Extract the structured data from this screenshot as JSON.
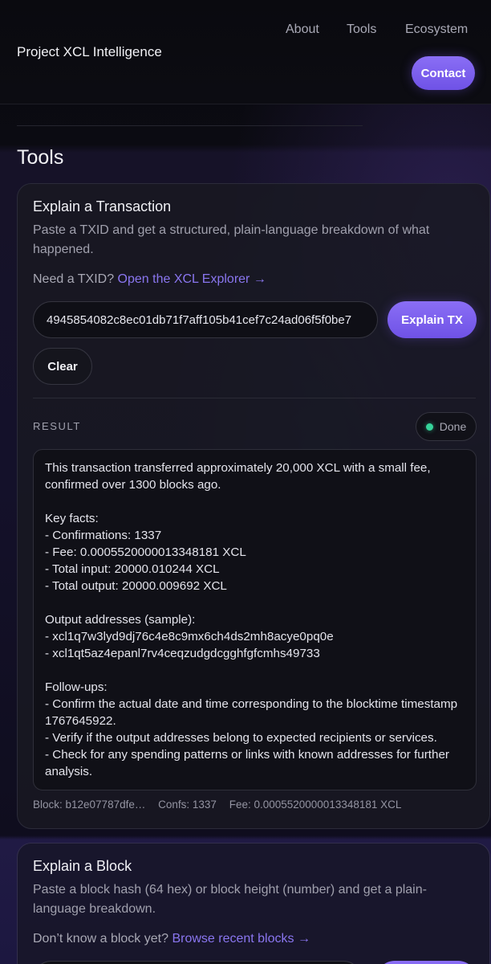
{
  "header": {
    "brand": "Project XCL Intelligence",
    "nav": [
      "About",
      "Tools",
      "Ecosystem"
    ],
    "contact_label": "Contact"
  },
  "section_title": "Tools",
  "tx_card": {
    "title": "Explain a Transaction",
    "description": "Paste a TXID and get a structured, plain-language breakdown of what happened.",
    "need_prefix": "Need a TXID?",
    "need_link": "Open the XCL Explorer →",
    "txid_value": "4945854082c8ec01db71f7aff105b41cef7c24ad06f5f0be7",
    "explain_label": "Explain TX",
    "clear_label": "Clear",
    "result_label": "RESULT",
    "status": "Done",
    "result_text": "This transaction transferred approximately 20,000 XCL with a small fee, confirmed over 1300 blocks ago.\n\nKey facts:\n- Confirmations: 1337\n- Fee: 0.0005520000013348181 XCL\n- Total input: 20000.010244 XCL\n- Total output: 20000.009692 XCL\n\nOutput addresses (sample):\n- xcl1q7w3lyd9dj76c4e8c9mx6ch4ds2mh8acye0pq0e\n- xcl1qt5az4epanl7rv4ceqzudgdcgghfgfcmhs49733\n\nFollow-ups:\n- Confirm the actual date and time corresponding to the blocktime timestamp 1767645922.\n- Verify if the output addresses belong to expected recipients or services.\n- Check for any spending patterns or links with known addresses for further analysis.",
    "meta": {
      "block": "Block: b12e07787dfe…",
      "confs": "Confs: 1337",
      "fee": "Fee: 0.0005520000013348181 XCL"
    }
  },
  "block_card": {
    "title": "Explain a Block",
    "description": "Paste a block hash (64 hex) or block height (number) and get a plain-language breakdown.",
    "need_prefix": "Don’t know a block yet?",
    "need_link": "Browse recent blocks →"
  },
  "colors": {
    "accent": "#7b5ff0",
    "link": "#8a76f0",
    "status_done": "#35d49a"
  }
}
